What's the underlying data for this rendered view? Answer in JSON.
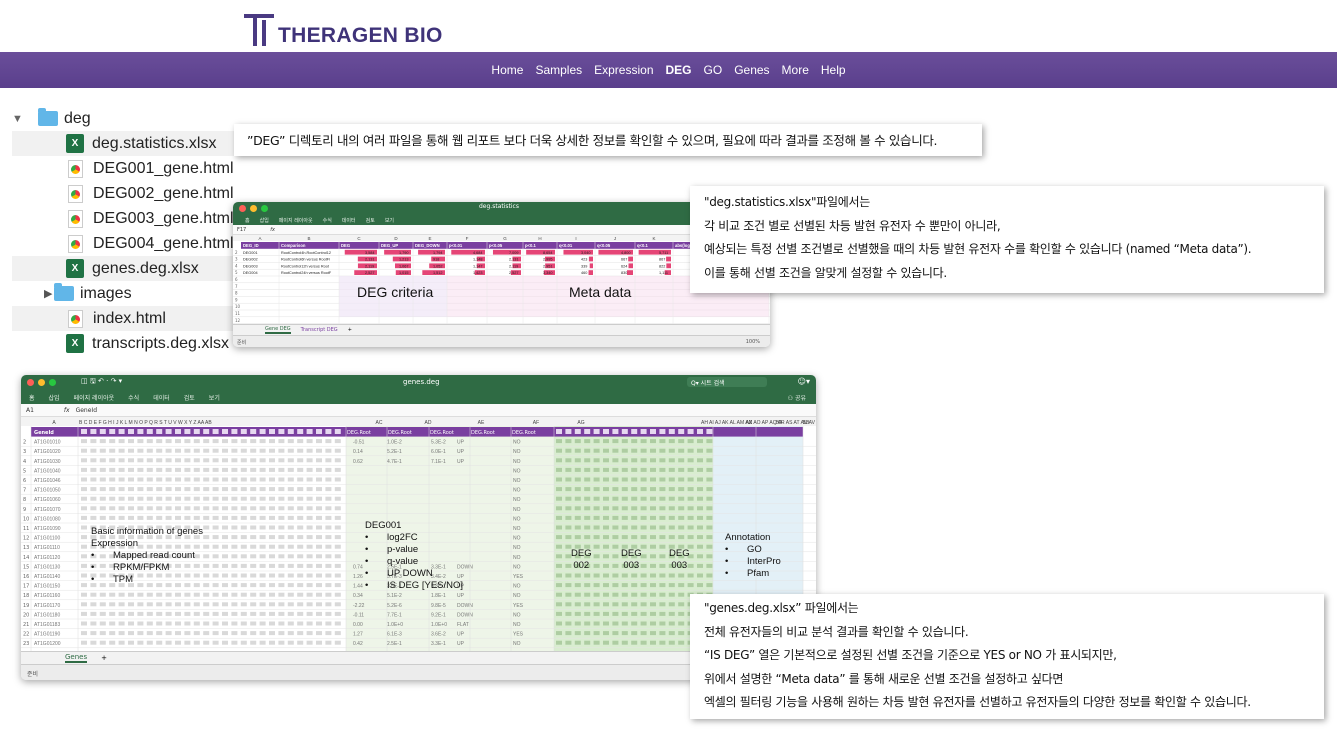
{
  "brand": {
    "name": "THERAGEN BIO",
    "color": "#4a3a82"
  },
  "nav": [
    {
      "label": "Home"
    },
    {
      "label": "Samples"
    },
    {
      "label": "Expression"
    },
    {
      "label": "DEG",
      "active": true
    },
    {
      "label": "GO"
    },
    {
      "label": "Genes"
    },
    {
      "label": "More"
    },
    {
      "label": "Help"
    }
  ],
  "tree": {
    "root": "deg",
    "items": [
      {
        "label": "deg.statistics.xlsx",
        "icon": "excel-icon"
      },
      {
        "label": "DEG001_gene.html",
        "icon": "html-icon"
      },
      {
        "label": "DEG002_gene.html",
        "icon": "html-icon"
      },
      {
        "label": "DEG003_gene.html",
        "icon": "html-icon"
      },
      {
        "label": "DEG004_gene.html",
        "icon": "html-icon"
      },
      {
        "label": "genes.deg.xlsx",
        "icon": "excel-icon"
      },
      {
        "label": "images",
        "icon": "folder-icon"
      },
      {
        "label": "index.html",
        "icon": "html-icon"
      },
      {
        "label": "transcripts.deg.xlsx",
        "icon": "excel-icon"
      }
    ]
  },
  "callout_top": "”DEG” 디렉토리 내의 여러 파일을 통해 웹 리포트 보다 더욱 상세한 정보를 확인할 수 있으며, 필요에 따라 결과를 조정해 볼 수 있습니다.",
  "callout_stats": [
    "\"deg.statistics.xlsx\"파일에서는",
    "각 비교 조건 별로 선별된 차등 발현 유전자 수 뿐만이 아니라,",
    "예상되는 특정 선별 조건별로 선별했을 때의 차등 발현 유전자 수를 확인할 수 있습니다 (named “Meta data”).",
    "이를 통해 선별 조건을 알맞게 설정할 수 있습니다."
  ],
  "callout_genes": [
    "\"genes.deg.xlsx” 파일에서는",
    "전체 유전자들의 비교 분석 결과를 확인할 수 있습니다.",
    "“IS DEG” 열은 기본적으로 설정된 선별 조건을 기준으로 YES or NO 가 표시되지만,",
    "위에서 설명한 “Meta data” 를 통해 새로운 선별 조건을 설정하고 싶다면",
    "엑셀의 필터링 기능을 사용해 원하는 차등 발현 유전자를 선별하고 유전자들의 다양한 정보를 확인할 수 있습니다."
  ],
  "excel_stats": {
    "title": "deg.statistics",
    "ribbon": [
      "홈",
      "삽입",
      "페이지 레이아웃",
      "수식",
      "데이터",
      "검토",
      "보기"
    ],
    "cell_ref": "F17",
    "fx": "fx",
    "col_letters": [
      "A",
      "B",
      "C",
      "D",
      "E",
      "F",
      "G",
      "H",
      "I",
      "J",
      "K",
      "L"
    ],
    "headers": [
      "DEG_ID",
      "Comparison",
      "DEG",
      "DEG_UP",
      "DEG_DOWN",
      "p<0.01",
      "p<0.05",
      "p<0.1",
      "q<0.01",
      "q<0.05",
      "q<0.1",
      "abs(log2FC)"
    ],
    "rows": [
      [
        "DEG001",
        "RootControl4h.RootControl12",
        "3,584",
        "1,790",
        "1,794",
        "4,684",
        "7,009",
        "8,654",
        "3,040",
        "4,800",
        "5,711",
        ""
      ],
      [
        "DEG002",
        "RootControl6h versus RootFl",
        "2,131",
        "1,213",
        "918",
        "1,148",
        "2,131",
        "2,995",
        "423",
        "667",
        "867",
        ""
      ],
      [
        "DEG003",
        "RootControl12h versus Root",
        "2,119",
        "1,067",
        "1,052",
        "1,147",
        "2,119",
        "2,951",
        "339",
        "624",
        "822",
        ""
      ],
      [
        "DEG004",
        "RootControl24h versus RootF",
        "2,527",
        "1,015",
        "1,512",
        "1,423",
        "2,527",
        "3,340",
        "460",
        "830",
        "1,111",
        ""
      ]
    ],
    "label_criteria": "DEG criteria",
    "label_meta": "Meta data",
    "tabs": [
      "Gene DEG",
      "Transcript DEG"
    ],
    "status_left": "준비",
    "zoom": "100%"
  },
  "excel_genes": {
    "title": "genes.deg",
    "ribbon": [
      "홈",
      "삽입",
      "페이지 레이아웃",
      "수식",
      "데이터",
      "검토",
      "보기"
    ],
    "share": "공유",
    "search": "시트 검색",
    "cell_ref": "A1",
    "fx": "fx",
    "fx_value": "GeneId",
    "col_letters": [
      "A",
      "B C D E F G H I J K L M N O P Q R S T U V W X Y Z AA AB",
      "AC",
      "AD",
      "AE",
      "AF",
      "AG",
      "AH AI AJ AK AL AM AN AO AP AQ AR AS AT AU AV AW AX AY",
      "AZ",
      "BA",
      "BB"
    ],
    "col1_header": "GeneId",
    "deg_header": "DEG.Root",
    "gene_ids": [
      "AT1G01010",
      "AT1G01020",
      "AT1G01030",
      "AT1G01040",
      "AT1G01046",
      "AT1G01050",
      "AT1G01060",
      "AT1G01070",
      "AT1G01080",
      "AT1G01090",
      "AT1G01100",
      "AT1G01110",
      "AT1G01120",
      "AT1G01130",
      "AT1G01140",
      "AT1G01150",
      "AT1G01160",
      "AT1G01170",
      "AT1G01180",
      "AT1G01183",
      "AT1G01190",
      "AT1G01200"
    ],
    "log2fc": [
      "-0.51",
      "0.14",
      "0.62",
      "",
      "",
      "",
      "",
      "",
      "",
      "",
      "",
      "",
      "",
      "0.74",
      "1.26",
      "1.44",
      "0.34",
      "-2.22",
      "-0.11",
      "0.00",
      "1.27",
      "0.42"
    ],
    "pval": [
      "1.0E-2",
      "5.2E-1",
      "4.7E-1",
      "",
      "",
      "",
      "",
      "",
      "",
      "",
      "",
      "",
      "",
      "2.5E-1",
      "5.7E-3",
      "3.6E-1",
      "5.1E-2",
      "5.2E-6",
      "7.7E-1",
      "1.0E+0",
      "6.1E-3",
      "2.5E-1"
    ],
    "qval": [
      "5.3E-2",
      "6.0E-1",
      "7.1E-1",
      "",
      "",
      "",
      "",
      "",
      "",
      "",
      "",
      "",
      "",
      "3.3E-1",
      "3.4E-2",
      "5.3E-1",
      "1.8E-1",
      "9.8E-5",
      "9.2E-1",
      "1.0E+0",
      "3.6E-2",
      "3.3E-1"
    ],
    "updown": [
      "UP",
      "UP",
      "UP",
      "",
      "",
      "",
      "",
      "",
      "",
      "",
      "",
      "",
      "",
      "DOWN",
      "UP",
      "UP",
      "UP",
      "DOWN",
      "DOWN",
      "FLAT",
      "UP",
      "UP"
    ],
    "isdeg": [
      "NO",
      "NO",
      "NO",
      "NO",
      "NO",
      "NO",
      "NO",
      "NO",
      "NO",
      "NO",
      "NO",
      "NO",
      "NO",
      "NO",
      "YES",
      "NO",
      "NO",
      "YES",
      "NO",
      "NO",
      "YES",
      "NO"
    ],
    "basic_title": "Basic information of genes",
    "basic_sub": "Expression",
    "basic_items": [
      "Mapped read count",
      "RPKM/FPKM",
      "TPM"
    ],
    "deg001_title": "DEG001",
    "deg001_items": [
      "log2FC",
      "p-value",
      "q-value",
      "UP DOWN",
      "IS DEG [YES/NO]"
    ],
    "deg_labels": [
      [
        "DEG",
        "002"
      ],
      [
        "DEG",
        "003"
      ],
      [
        "DEG",
        "003"
      ]
    ],
    "anno_title": "Annotation",
    "anno_items": [
      "GO",
      "InterPro",
      "Pfam"
    ],
    "tabs": [
      "Genes"
    ],
    "status_left": "준비"
  },
  "colors": {
    "excel_green": "#2f6b44",
    "nav_purple": "#5f4591",
    "header_purple": "#7a3fa0"
  }
}
